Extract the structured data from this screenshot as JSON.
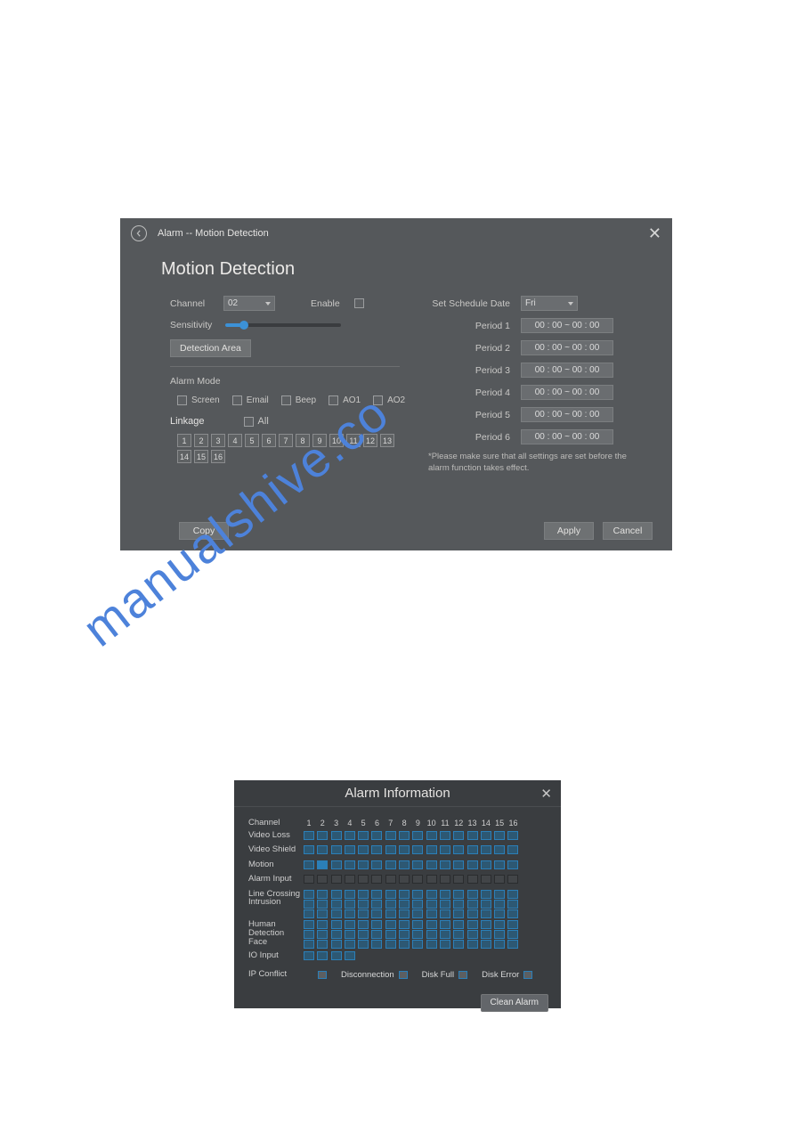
{
  "watermark": "manualshive.co",
  "panel1": {
    "breadcrumb": "Alarm -- Motion Detection",
    "title": "Motion Detection",
    "channel_label": "Channel",
    "channel_value": "02",
    "enable_label": "Enable",
    "sensitivity_label": "Sensitivity",
    "detection_area_btn": "Detection Area",
    "alarm_mode_label": "Alarm Mode",
    "modes": {
      "screen": "Screen",
      "email": "Email",
      "beep": "Beep",
      "ao1": "AO1",
      "ao2": "AO2"
    },
    "linkage_label": "Linkage",
    "all_label": "All",
    "linkage_channels": [
      "1",
      "2",
      "3",
      "4",
      "5",
      "6",
      "7",
      "8",
      "9",
      "10",
      "11",
      "12",
      "13",
      "14",
      "15",
      "16"
    ],
    "schedule": {
      "set_schedule_label": "Set Schedule",
      "date_label": "Date",
      "date_value": "Fri",
      "periods": [
        {
          "label": "Period 1",
          "value": "00 : 00  ~  00 : 00"
        },
        {
          "label": "Period 2",
          "value": "00 : 00  ~  00 : 00"
        },
        {
          "label": "Period 3",
          "value": "00 : 00  ~  00 : 00"
        },
        {
          "label": "Period 4",
          "value": "00 : 00  ~  00 : 00"
        },
        {
          "label": "Period 5",
          "value": "00 : 00  ~  00 : 00"
        },
        {
          "label": "Period 6",
          "value": "00 : 00  ~  00 : 00"
        }
      ],
      "note": "*Please make sure that all settings are set before the alarm function takes effect."
    },
    "footer": {
      "copy": "Copy",
      "apply": "Apply",
      "cancel": "Cancel"
    }
  },
  "panel2": {
    "title": "Alarm Information",
    "channel_label": "Channel",
    "channels": [
      "1",
      "2",
      "3",
      "4",
      "5",
      "6",
      "7",
      "8",
      "9",
      "10",
      "11",
      "12",
      "13",
      "14",
      "15",
      "16"
    ],
    "rows": [
      {
        "label": "Video Loss",
        "blue": true
      },
      {
        "label": "Video Shield",
        "blue": true
      },
      {
        "label": "Motion",
        "blue": true,
        "filled": [
          2
        ]
      },
      {
        "label": "Alarm Input",
        "blue": false
      },
      {
        "label": "Line Crossing Intrusion",
        "multi": 3,
        "blue": true
      },
      {
        "label": "Human Detection Face",
        "multi": 3,
        "blue": true
      },
      {
        "label": "IO Input",
        "short": 4,
        "blue": true
      }
    ],
    "bottom": {
      "ip_conflict": "IP Conflict",
      "disconnection": "Disconnection",
      "disk_full": "Disk Full",
      "disk_error": "Disk Error"
    },
    "clean_btn": "Clean Alarm"
  }
}
